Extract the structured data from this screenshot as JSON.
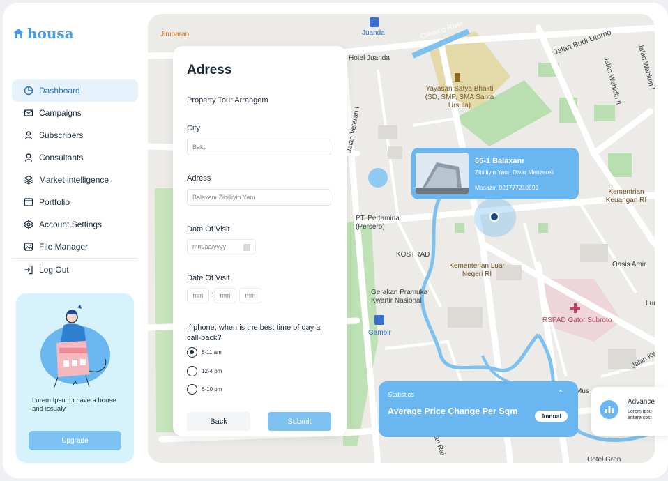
{
  "brand": {
    "name": "housa",
    "color": "#4a9be6"
  },
  "sidebar": {
    "items": [
      {
        "label": "Dashboard",
        "icon": "pie-chart-icon",
        "active": true
      },
      {
        "label": "Campaigns",
        "icon": "mail-icon"
      },
      {
        "label": "Subscribers",
        "icon": "user-icon"
      },
      {
        "label": "Consultants",
        "icon": "consultant-icon"
      },
      {
        "label": "Market intelligence",
        "icon": "layers-icon"
      },
      {
        "label": "Portfolio",
        "icon": "window-icon"
      },
      {
        "label": "Account Settings",
        "icon": "gear-icon"
      },
      {
        "label": "File Manager",
        "icon": "image-icon"
      }
    ],
    "logout": {
      "label": "Log Out",
      "icon": "logout-icon"
    },
    "upgrade": {
      "text": "Lorem Ipsum ı have a house and ıssualy",
      "button": "Upgrade"
    }
  },
  "map": {
    "labels": {
      "jimbaran": "Jimbaran",
      "juanda": "Juanda",
      "ciliwung": "Ciliwung River",
      "jalan_budi": "Jalan Budi Utomo",
      "hotel_juanda": "Hotel Juanda",
      "yayasan": "Yayasan Satya Bhakti (SD, SMP, SMA Santa Ursula)",
      "jalan_wahidin": "Jalan Wahidin II",
      "jalan_wahidin_1": "Jalan Wahidin I",
      "jalan_veteran": "Jalan Veteran I",
      "pertamina": "PT. Pertamina (Persero)",
      "kostrad": "KOSTRAD",
      "kementerian_lu": "Kementerian Luar Negeri RI",
      "kementrian_keu": "Kementrian Keuangan RI",
      "oasis": "Oasis Amir",
      "gerakan": "Gerakan Pramuka Kwartir Nasional",
      "gambir": "Gambir",
      "rspad": "RSPAD Gator Subroto",
      "hotel_gren": "Hotel Gren",
      "jalan_kwi": "Jalan Kwi",
      "lur": "Lur",
      "mus": "Mus",
      "wan_rai": "wan Rai"
    }
  },
  "form": {
    "title": "Adress",
    "subtitle": "Property Tour Arrangem",
    "city_label": "City",
    "city_value": "Baku",
    "address_label": "Adress",
    "address_value": "Balaxanı Zibilliyin Yanı",
    "date_label_1": "Date Of Visit",
    "date_placeholder": "mm/aa/yyyy",
    "date_label_2": "Date Of Visit",
    "time_mm_1": "mm",
    "time_sep": ":",
    "time_mm_2": "mm",
    "time_mm_3": "mm",
    "question": "If phone, when is the best time of day a call-back?",
    "options": [
      {
        "label": "8-11 am",
        "selected": true
      },
      {
        "label": "12-4 pm",
        "selected": false
      },
      {
        "label": "6-10 pm",
        "selected": false
      }
    ],
    "back": "Back",
    "submit": "Submit"
  },
  "popup": {
    "title": "65-1 Balaxanı",
    "line1": "Zibilliyin Yanı, Divar Menzereli",
    "line2": "Masazır, 021777210599"
  },
  "stats": {
    "label": "Statistics",
    "title": "Average Price Change Per Sqm",
    "period": "Annual"
  },
  "advanced": {
    "title": "Advance",
    "line1": "Lorem ipsu",
    "line2": "antere cost"
  },
  "colors": {
    "accent": "#6ab6f0",
    "active_bg": "#e5f1fb",
    "upgrade_bg": "#d6f2fd"
  }
}
